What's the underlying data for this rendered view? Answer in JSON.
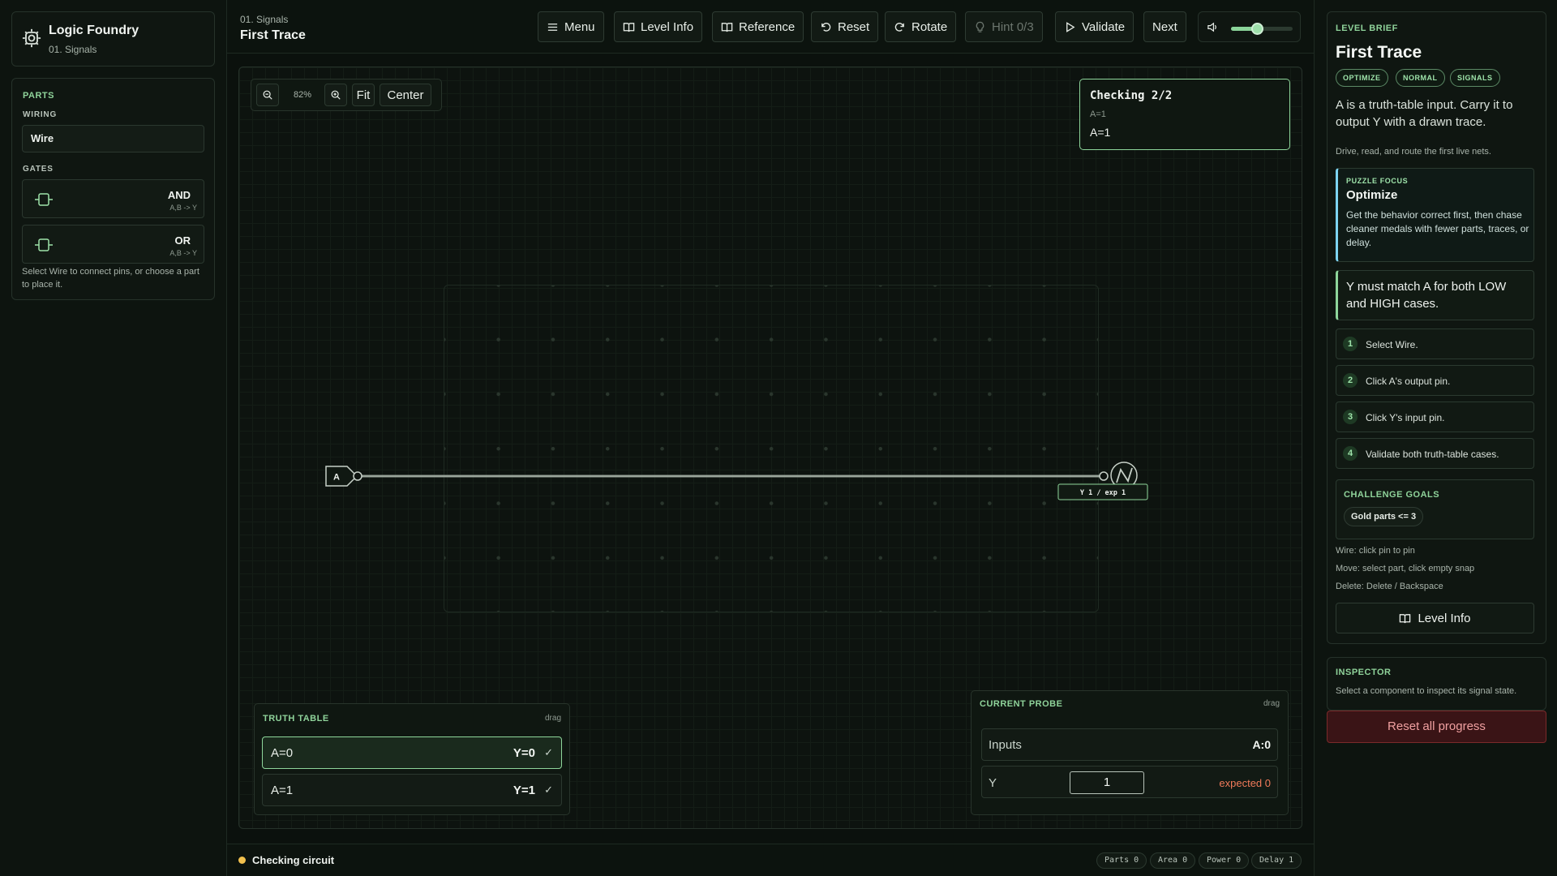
{
  "app": {
    "name": "Logic Foundry",
    "chapter": "01. Signals"
  },
  "parts": {
    "heading": "PARTS",
    "wiring_heading": "WIRING",
    "wire_label": "Wire",
    "gates_heading": "GATES",
    "gates": [
      {
        "name": "AND",
        "signature": "A,B -> Y"
      },
      {
        "name": "OR",
        "signature": "A,B -> Y"
      }
    ],
    "hint": "Select Wire to connect pins, or choose a part to place it."
  },
  "header": {
    "breadcrumb": "01. Signals",
    "title": "First Trace",
    "buttons": {
      "menu": "Menu",
      "level_info": "Level Info",
      "reference": "Reference",
      "reset": "Reset",
      "rotate": "Rotate",
      "hint": "Hint 0/3",
      "validate": "Validate",
      "next": "Next"
    },
    "volume_level": 0.42
  },
  "board": {
    "zoom": {
      "level": "82%",
      "fit": "Fit",
      "center": "Center"
    },
    "checking": {
      "title": "Checking 2/2",
      "case": "A=1",
      "value": "A=1"
    },
    "input_label": "A",
    "output_label": "Y 1 / exp 1"
  },
  "truth_table": {
    "heading": "TRUTH TABLE",
    "drag": "drag",
    "rows": [
      {
        "input": "A=0",
        "output": "Y=0",
        "check": "✓"
      },
      {
        "input": "A=1",
        "output": "Y=1",
        "check": "✓"
      }
    ]
  },
  "probe": {
    "heading": "CURRENT PROBE",
    "drag": "drag",
    "inputs_label": "Inputs",
    "inputs_value": "A:0",
    "y_label": "Y",
    "y_value": "1",
    "expected": "expected 0"
  },
  "status": {
    "text": "Checking circuit",
    "chips": [
      "Parts 0",
      "Area 0",
      "Power 0",
      "Delay 1"
    ],
    "color": "#f2c14e"
  },
  "brief": {
    "heading": "LEVEL BRIEF",
    "title": "First Trace",
    "tags": [
      "OPTIMIZE",
      "NORMAL",
      "SIGNALS"
    ],
    "description": "A is a truth-table input. Carry it to output Y with a drawn trace.",
    "subtext": "Drive, read, and route the first live nets.",
    "focus": {
      "heading": "PUZZLE FOCUS",
      "title": "Optimize",
      "text": "Get the behavior correct first, then chase cleaner medals with fewer parts, traces, or delay."
    },
    "requirement": "Y must match A for both LOW and HIGH cases.",
    "steps": [
      {
        "num": "1",
        "text": "Select Wire."
      },
      {
        "num": "2",
        "text": "Click A's output pin."
      },
      {
        "num": "3",
        "text": "Click Y's input pin."
      },
      {
        "num": "4",
        "text": "Validate both truth-table cases."
      }
    ],
    "goals": {
      "heading": "CHALLENGE GOALS",
      "chip": "Gold parts <= 3"
    },
    "shortcuts": [
      "Wire: click pin to pin",
      "Move: select part, click empty snap",
      "Delete: Delete / Backspace"
    ],
    "level_info_button": "Level Info"
  },
  "inspector": {
    "heading": "INSPECTOR",
    "text": "Select a component to inspect its signal state."
  },
  "reset_all": "Reset all progress",
  "colors": {
    "accent": "#8ed69b",
    "warning": "#f07a5a",
    "focus": "#7dd3f0"
  }
}
